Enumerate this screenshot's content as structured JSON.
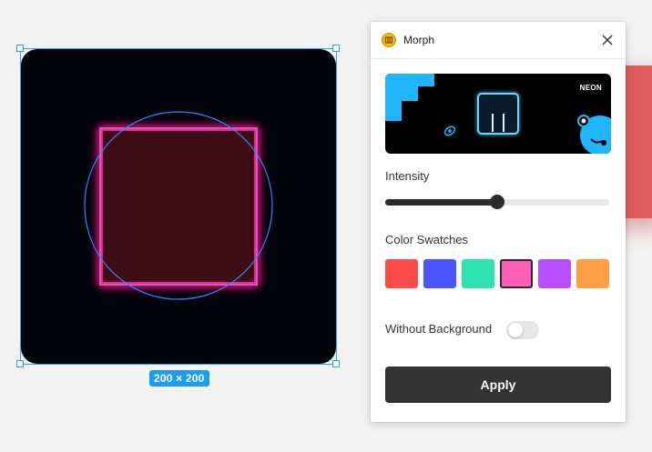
{
  "canvas": {
    "size_badge": "200 × 200",
    "frame_color": "#02040c",
    "neon_square_color": "#ff1a8c",
    "circle_color": "#2f86f5",
    "selection_color": "#2f9bff"
  },
  "panel": {
    "title": "Morph",
    "plugin_icon": "morph-logo-icon",
    "close_icon": "close-icon",
    "preview": {
      "label": "NEON",
      "accent": "#1fb6ff"
    },
    "intensity": {
      "label": "Intensity",
      "value": 0.5
    },
    "swatches": {
      "label": "Color Swatches",
      "colors": [
        "#ff4a4a",
        "#4a55ff",
        "#2de3b0",
        "#ff5cb8",
        "#b84dff",
        "#ff9e45"
      ],
      "selected_index": 3
    },
    "without_background": {
      "label": "Without Background",
      "enabled": false
    },
    "apply_label": "Apply"
  }
}
